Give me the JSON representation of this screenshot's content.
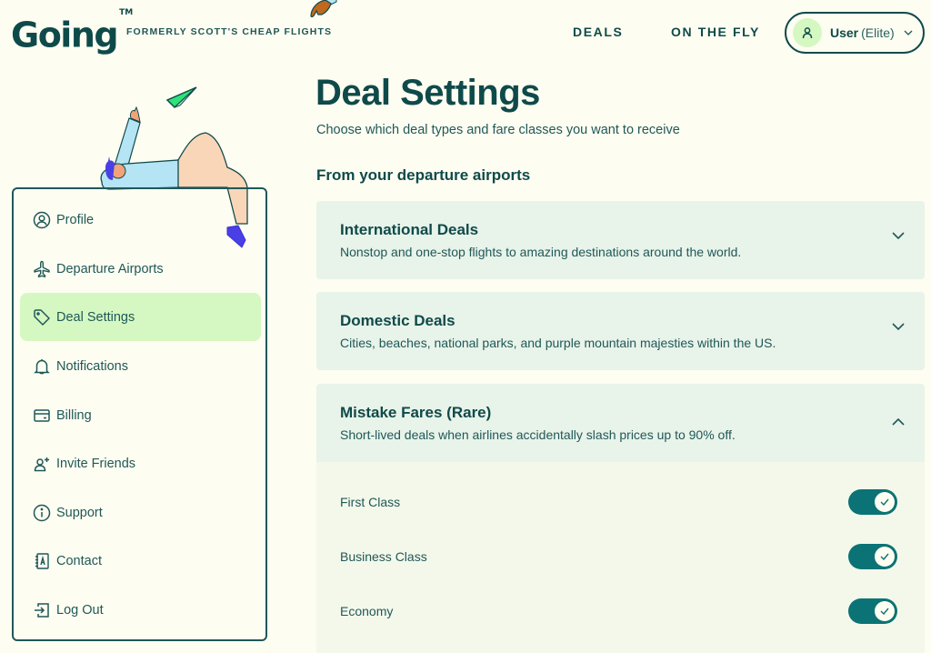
{
  "header": {
    "logo": "Going",
    "trademark": "TM",
    "tagline": "FORMERLY SCOTT'S CHEAP FLIGHTS",
    "nav": [
      {
        "label": "DEALS"
      },
      {
        "label": "ON THE FLY"
      }
    ],
    "user": {
      "name": "User",
      "tier": "(Elite)"
    }
  },
  "sidebar": {
    "items": [
      {
        "label": "Profile",
        "icon": "user-circle-icon"
      },
      {
        "label": "Departure Airports",
        "icon": "airplane-icon"
      },
      {
        "label": "Deal Settings",
        "icon": "tag-icon",
        "active": true
      },
      {
        "label": "Notifications",
        "icon": "bell-icon"
      },
      {
        "label": "Billing",
        "icon": "credit-card-icon"
      },
      {
        "label": "Invite Friends",
        "icon": "user-plus-icon"
      },
      {
        "label": "Support",
        "icon": "info-icon"
      },
      {
        "label": "Contact",
        "icon": "address-book-icon"
      },
      {
        "label": "Log Out",
        "icon": "log-out-icon"
      }
    ]
  },
  "main": {
    "title": "Deal Settings",
    "subtitle": "Choose which deal types and fare classes you want to receive",
    "section_title": "From your departure airports",
    "accordions": [
      {
        "title": "International Deals",
        "description": "Nonstop and one-stop flights to amazing destinations around the world.",
        "expanded": false
      },
      {
        "title": "Domestic Deals",
        "description": "Cities, beaches, national parks, and purple mountain majesties within the US.",
        "expanded": false
      },
      {
        "title": "Mistake Fares (Rare)",
        "description": "Short-lived deals when airlines accidentally slash prices up to 90% off.",
        "expanded": true,
        "fares": [
          {
            "label": "First Class",
            "enabled": true
          },
          {
            "label": "Business Class",
            "enabled": true
          },
          {
            "label": "Economy",
            "enabled": true
          }
        ]
      }
    ]
  },
  "colors": {
    "background": "#fefdf1",
    "primary_text": "#0f4a4a",
    "active_nav": "#d5f8c2",
    "accordion_bg": "#e8f3e9",
    "toggle_on": "#0b7375"
  }
}
